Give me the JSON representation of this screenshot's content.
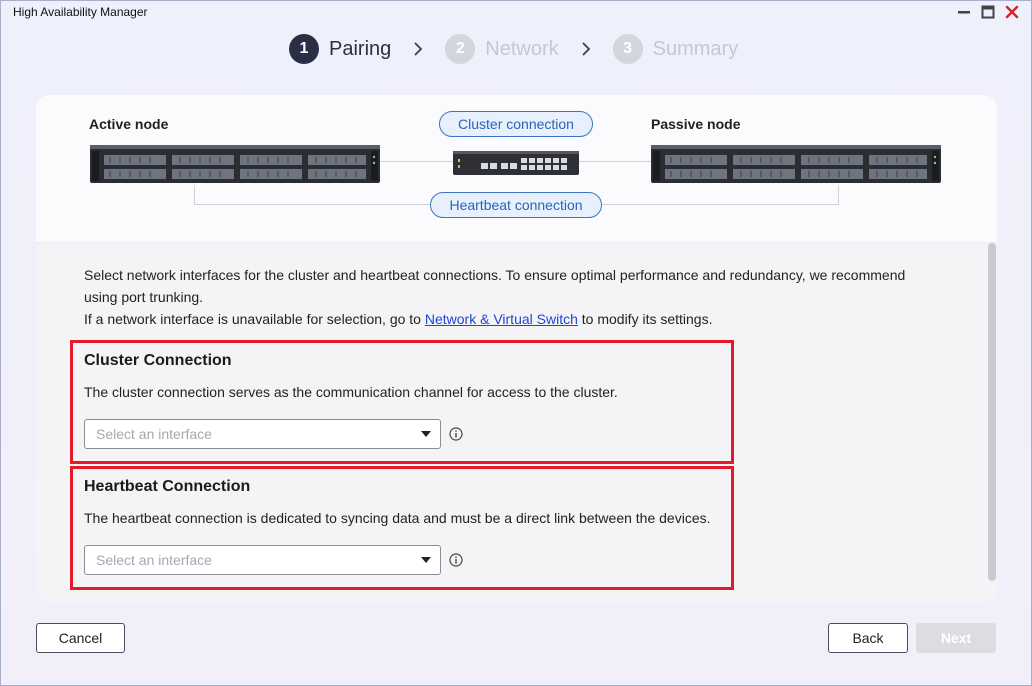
{
  "window": {
    "title": "High Availability Manager"
  },
  "stepper": {
    "steps": [
      {
        "number": "1",
        "label": "Pairing",
        "state": "active"
      },
      {
        "number": "2",
        "label": "Network",
        "state": "inactive"
      },
      {
        "number": "3",
        "label": "Summary",
        "state": "inactive"
      }
    ]
  },
  "diagram": {
    "active_node_label": "Active node",
    "passive_node_label": "Passive node",
    "cluster_connection_label": "Cluster connection",
    "heartbeat_connection_label": "Heartbeat connection"
  },
  "intro": {
    "line1": "Select network interfaces for the cluster and heartbeat connections. To ensure optimal performance and redundancy, we recommend using port trunking.",
    "line2_prefix": "If a network interface is unavailable for selection, go to ",
    "line2_link": "Network & Virtual Switch",
    "line2_suffix": " to modify its settings."
  },
  "cluster": {
    "title": "Cluster Connection",
    "description": "The cluster connection serves as the communication channel for access to the cluster.",
    "select_placeholder": "Select an interface"
  },
  "heartbeat": {
    "title": "Heartbeat Connection",
    "description": "The heartbeat connection is dedicated to syncing data and must be a direct link between the devices.",
    "select_placeholder": "Select an interface"
  },
  "footer": {
    "cancel_label": "Cancel",
    "back_label": "Back",
    "next_label": "Next"
  },
  "colors": {
    "highlight_border": "#e21b2b",
    "link": "#1a47d6",
    "pill_accent": "#3b74c4",
    "step_active": "#2b2f45"
  }
}
